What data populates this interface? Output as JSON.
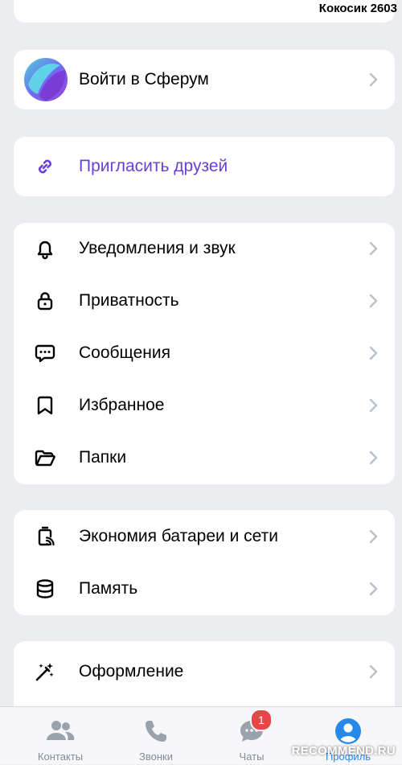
{
  "header": {
    "username": "Кокосик 2603"
  },
  "sferum": {
    "label": "Войти в Сферум"
  },
  "invite": {
    "label": "Пригласить друзей",
    "color": "#6b3fd6"
  },
  "settings_group_1": {
    "items": [
      {
        "label": "Уведомления и звук",
        "icon": "bell-icon"
      },
      {
        "label": "Приватность",
        "icon": "lock-icon"
      },
      {
        "label": "Сообщения",
        "icon": "message-icon"
      },
      {
        "label": "Избранное",
        "icon": "bookmark-icon"
      },
      {
        "label": "Папки",
        "icon": "folder-icon"
      }
    ]
  },
  "settings_group_2": {
    "items": [
      {
        "label": "Экономия батареи и сети",
        "icon": "battery-saver-icon"
      },
      {
        "label": "Память",
        "icon": "storage-icon"
      }
    ]
  },
  "settings_group_3": {
    "items": [
      {
        "label": "Оформление",
        "icon": "magic-wand-icon"
      }
    ]
  },
  "tabbar": {
    "tabs": [
      {
        "label": "Контакты",
        "icon": "contacts-icon"
      },
      {
        "label": "Звонки",
        "icon": "phone-icon"
      },
      {
        "label": "Чаты",
        "icon": "chat-icon",
        "badge": "1"
      },
      {
        "label": "Профиль",
        "icon": "profile-icon",
        "active": true
      }
    ]
  },
  "watermark": {
    "text": "RECOMMEND.RU"
  },
  "colors": {
    "accent": "#2688eb",
    "badge": "#e64646",
    "chevron": "#b8c1cc"
  }
}
